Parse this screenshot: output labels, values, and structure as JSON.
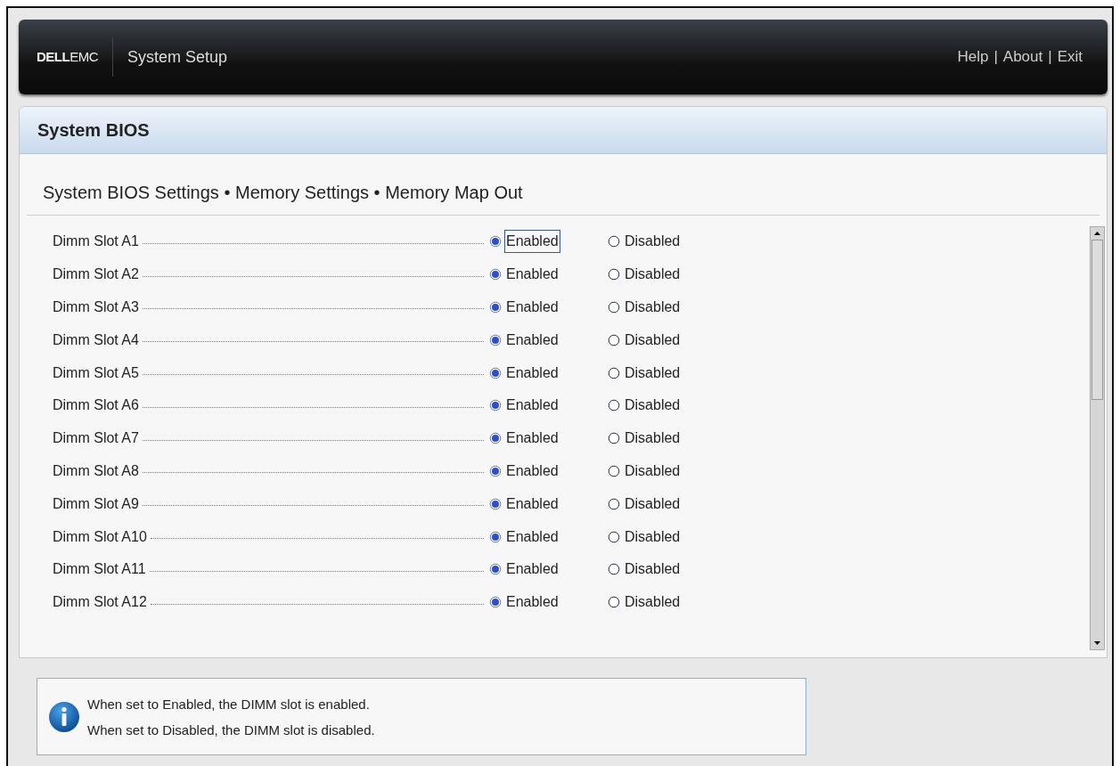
{
  "header": {
    "logo": "**DELL**EMC",
    "title": "System Setup",
    "links": [
      "Help",
      "About",
      "Exit"
    ],
    "separator": "|"
  },
  "panel": {
    "title": "System BIOS",
    "breadcrumb": "System BIOS Settings • Memory Settings • Memory Map Out"
  },
  "settings": [
    {
      "label": "Dimm Slot A1",
      "focused": true,
      "options": [
        {
          "label": "Enabled",
          "selected": true
        },
        {
          "label": "Disabled",
          "selected": false
        }
      ]
    },
    {
      "label": "Dimm Slot A2",
      "focused": false,
      "options": [
        {
          "label": "Enabled",
          "selected": true
        },
        {
          "label": "Disabled",
          "selected": false
        }
      ]
    },
    {
      "label": "Dimm Slot A3",
      "focused": false,
      "options": [
        {
          "label": "Enabled",
          "selected": true
        },
        {
          "label": "Disabled",
          "selected": false
        }
      ]
    },
    {
      "label": "Dimm Slot A4",
      "focused": false,
      "options": [
        {
          "label": "Enabled",
          "selected": true
        },
        {
          "label": "Disabled",
          "selected": false
        }
      ]
    },
    {
      "label": "Dimm Slot A5",
      "focused": false,
      "options": [
        {
          "label": "Enabled",
          "selected": true
        },
        {
          "label": "Disabled",
          "selected": false
        }
      ]
    },
    {
      "label": "Dimm Slot A6",
      "focused": false,
      "options": [
        {
          "label": "Enabled",
          "selected": true
        },
        {
          "label": "Disabled",
          "selected": false
        }
      ]
    },
    {
      "label": "Dimm Slot A7",
      "focused": false,
      "options": [
        {
          "label": "Enabled",
          "selected": true
        },
        {
          "label": "Disabled",
          "selected": false
        }
      ]
    },
    {
      "label": "Dimm Slot A8",
      "focused": false,
      "options": [
        {
          "label": "Enabled",
          "selected": true
        },
        {
          "label": "Disabled",
          "selected": false
        }
      ]
    },
    {
      "label": "Dimm Slot A9",
      "focused": false,
      "options": [
        {
          "label": "Enabled",
          "selected": true
        },
        {
          "label": "Disabled",
          "selected": false
        }
      ]
    },
    {
      "label": "Dimm Slot A10",
      "focused": false,
      "options": [
        {
          "label": "Enabled",
          "selected": true
        },
        {
          "label": "Disabled",
          "selected": false
        }
      ]
    },
    {
      "label": "Dimm Slot A11",
      "focused": false,
      "options": [
        {
          "label": "Enabled",
          "selected": true
        },
        {
          "label": "Disabled",
          "selected": false
        }
      ]
    },
    {
      "label": "Dimm Slot A12",
      "focused": false,
      "options": [
        {
          "label": "Enabled",
          "selected": true
        },
        {
          "label": "Disabled",
          "selected": false
        }
      ]
    }
  ],
  "help": {
    "lines": [
      "When set to Enabled, the DIMM slot is enabled.",
      "When set to Disabled, the DIMM slot is disabled."
    ]
  }
}
